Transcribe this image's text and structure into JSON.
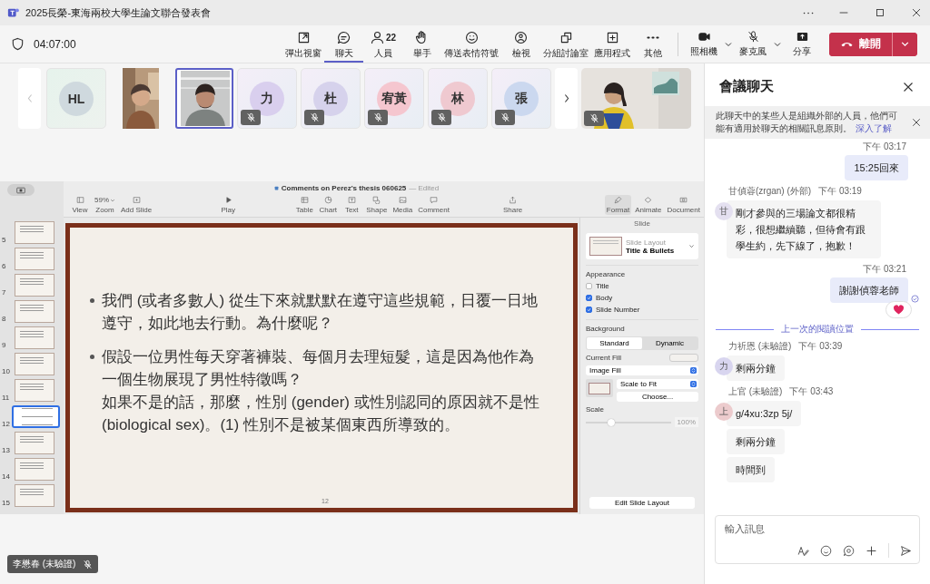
{
  "window": {
    "title": "2025長榮-東海兩校大學生論文聯合發表會"
  },
  "meeting_bar": {
    "timer": "04:07:00",
    "buttons": [
      {
        "label": "彈出視窗",
        "selected": false
      },
      {
        "label": "聊天",
        "selected": true
      },
      {
        "label": "人員",
        "badge": "22",
        "selected": false
      },
      {
        "label": "舉手",
        "selected": false
      },
      {
        "label": "傳送表情符號",
        "selected": false
      },
      {
        "label": "檢視",
        "selected": false
      },
      {
        "label": "分組討論室",
        "selected": false
      },
      {
        "label": "應用程式",
        "selected": false
      },
      {
        "label": "其他",
        "selected": false
      }
    ],
    "camera": {
      "label": "照相機",
      "on": true
    },
    "mic": {
      "label": "麥克風",
      "muted": true
    },
    "share": {
      "label": "分享"
    },
    "leave": {
      "label": "離開"
    }
  },
  "participants": {
    "prev": {
      "disabled": true
    },
    "next": {
      "disabled": false
    },
    "tiles": [
      {
        "kind": "avatar",
        "initials": "HL",
        "color": "#cfd9de",
        "muted": false,
        "selected": false
      },
      {
        "kind": "portrait_video",
        "muted": false,
        "selected": false
      },
      {
        "kind": "video",
        "muted": false,
        "selected": true
      },
      {
        "kind": "avatar",
        "initials": "力",
        "color": "#d9cfee",
        "muted": true,
        "selected": false
      },
      {
        "kind": "avatar",
        "initials": "杜",
        "color": "#d6d2ec",
        "muted": true,
        "selected": false
      },
      {
        "kind": "avatar",
        "initials": "宥黃",
        "color": "#f5c6cf",
        "muted": true,
        "selected": false
      },
      {
        "kind": "avatar",
        "initials": "林",
        "color": "#efc9d0",
        "muted": true,
        "selected": false
      },
      {
        "kind": "avatar",
        "initials": "張",
        "color": "#cbd8ef",
        "muted": true,
        "selected": false
      }
    ],
    "spotlight": {
      "kind": "wide_video",
      "muted": true
    }
  },
  "keynote": {
    "title": "Comments on Perez's thesis 060625",
    "status": "— Edited",
    "toolbar": [
      [
        {
          "label": "View",
          "kind": "button",
          "selected": false
        },
        {
          "label": "Zoom",
          "kind": "dropdown",
          "value": "59%",
          "selected": false
        },
        {
          "label": "Add Slide",
          "kind": "button",
          "selected": false
        }
      ],
      [
        {
          "label": "Play",
          "kind": "button",
          "selected": false
        }
      ],
      [
        {
          "label": "Table",
          "kind": "button",
          "selected": false
        },
        {
          "label": "Chart",
          "kind": "button",
          "selected": false
        },
        {
          "label": "Text",
          "kind": "button",
          "selected": false
        },
        {
          "label": "Shape",
          "kind": "button",
          "selected": false
        },
        {
          "label": "Media",
          "kind": "button",
          "selected": false
        },
        {
          "label": "Comment",
          "kind": "button",
          "selected": false
        }
      ],
      [
        {
          "label": "Share",
          "kind": "button",
          "selected": false
        }
      ],
      [
        {
          "label": "Format",
          "kind": "button",
          "selected": true
        },
        {
          "label": "Animate",
          "kind": "button",
          "selected": false
        },
        {
          "label": "Document",
          "kind": "button",
          "selected": false
        }
      ]
    ],
    "slides": [
      {
        "number": "5",
        "selected": false
      },
      {
        "number": "6",
        "selected": false
      },
      {
        "number": "7",
        "selected": false
      },
      {
        "number": "8",
        "selected": false
      },
      {
        "number": "9",
        "selected": false
      },
      {
        "number": "10",
        "selected": false
      },
      {
        "number": "11",
        "selected": false
      },
      {
        "number": "12",
        "selected": true
      },
      {
        "number": "13",
        "selected": false
      },
      {
        "number": "14",
        "selected": false
      },
      {
        "number": "15",
        "selected": false
      }
    ],
    "slide": {
      "bullets": [
        {
          "lines": [
            "我們 (或者多數人) 從生下來就默默在遵守這些規範，日覆一日地遵守，如此地去行動。為什麼呢？"
          ]
        },
        {
          "lines": [
            "假設一位男性每天穿著褲裝、每個月去理短髮，這是因為他作為一個生物展現了男性特徵嗎？",
            "如果不是的話，那麼，性別 (gender) 或性別認同的原因就不是性 (biological sex)。(1) 性別不是被某個東西所導致的。"
          ]
        }
      ],
      "page": "12"
    },
    "inspector": {
      "heading": "Slide",
      "layout_label": "Slide Layout",
      "layout": "Title & Bullets",
      "appearance_heading": "Appearance",
      "appearance": [
        {
          "label": "Title",
          "checked": false
        },
        {
          "label": "Body",
          "checked": true
        },
        {
          "label": "Slide Number",
          "checked": true
        }
      ],
      "background_heading": "Background",
      "background_modes": [
        {
          "label": "Standard",
          "selected": true
        },
        {
          "label": "Dynamic",
          "selected": false
        }
      ],
      "current_fill": "Current Fill",
      "fill_type": "Image Fill",
      "scaling": "Scale to Fit",
      "choose": "Choose...",
      "scale_label": "Scale",
      "scale": {
        "level": 0.3
      },
      "scale_value": "100%",
      "edit_layout": "Edit Slide Layout"
    }
  },
  "chat": {
    "title": "會議聊天",
    "notice": {
      "text": "此聊天中的某些人是組織外部的人員，他們可能有適用於聊天的相關訊息原則。",
      "link": "深入了解"
    },
    "messages": [
      {
        "kind": "mine",
        "time": "下午 03:17",
        "texts": [
          "15:25回來"
        ],
        "reaction": false,
        "seen": false
      },
      {
        "kind": "other",
        "sender": "甘偵蓉(zrgan) (外部)",
        "time": "下午 03:19",
        "avatar": "甘",
        "color": "#e4e0f0",
        "texts": [
          "剛才參與的三場論文都很精彩，很想繼續聽，但待會有跟學生約，先下線了，抱歉！"
        ]
      },
      {
        "kind": "mine",
        "time": "下午 03:21",
        "texts": [
          "謝謝偵蓉老師"
        ],
        "reaction": true,
        "seen": true
      },
      {
        "kind": "divider",
        "text": "上一次的閱讀位置"
      },
      {
        "kind": "other",
        "sender": "力祈恩 (未驗證)",
        "time": "下午 03:39",
        "avatar": "力",
        "color": "#d8d5ef",
        "texts": [
          "剩兩分鐘"
        ]
      },
      {
        "kind": "other",
        "sender": "上官 (未驗證)",
        "time": "下午 03:43",
        "avatar": "上",
        "color": "#eccbcd",
        "texts": [
          "g/4xu:3zp 5j/",
          "剩兩分鐘",
          "時間到"
        ]
      }
    ],
    "input": {
      "placeholder": "輸入訊息"
    }
  },
  "name_tag": {
    "name": "李懋春 (未驗證)",
    "muted": true
  }
}
